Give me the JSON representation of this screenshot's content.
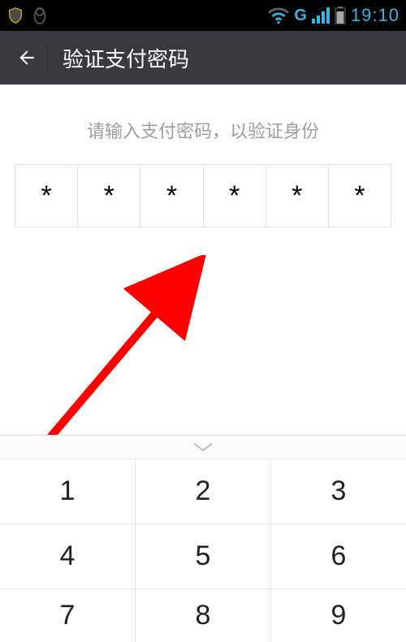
{
  "statusBar": {
    "network": "G",
    "time": "19:10"
  },
  "header": {
    "title": "验证支付密码"
  },
  "prompt": "请输入支付密码，以验证身份",
  "pin": {
    "cells": [
      "*",
      "*",
      "*",
      "*",
      "*",
      "*"
    ]
  },
  "keypad": {
    "rows": [
      [
        "1",
        "2",
        "3"
      ],
      [
        "4",
        "5",
        "6"
      ],
      [
        "7",
        "8",
        "9"
      ]
    ]
  },
  "colors": {
    "statusAccent": "#33b5e5",
    "headerBg": "#393a3f",
    "arrow": "#ff0000"
  }
}
